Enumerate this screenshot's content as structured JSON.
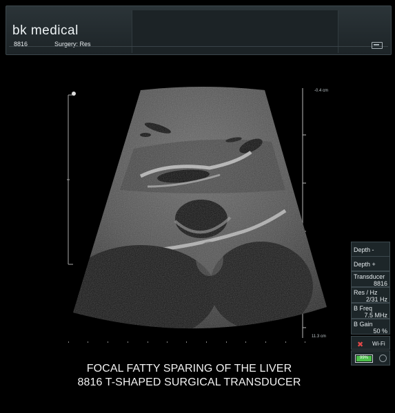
{
  "header": {
    "brand": "bk medical",
    "transducer_id": "8816",
    "mode_label": "Surgery: Res"
  },
  "scan": {
    "depth_top": "-0.4 cm",
    "depth_bottom": "11.3 cm"
  },
  "caption": {
    "line1": "FOCAL FATTY SPARING OF THE LIVER",
    "line2": "8816  T-SHAPED SURGICAL TRANSDUCER"
  },
  "controls": {
    "depth_minus": "Depth -",
    "depth_plus": "Depth +",
    "transducer_label": "Transducer",
    "transducer_value": "8816",
    "res_label": "Res / Hz",
    "res_value": "2/31 Hz",
    "bfreq_label": "B Freq",
    "bfreq_value": "7.5 MHz",
    "bgain_label": "B Gain",
    "bgain_value": "50 %",
    "wifi_label": "Wi-Fi",
    "battery_text": "99%",
    "battery_level": 0.99
  },
  "colors": {
    "accent": "#4cc04b",
    "wifi_off": "#e14848",
    "panel_bg": "#1d2629"
  },
  "icons": [
    "wifi-off-icon",
    "battery-icon",
    "power-icon",
    "storage-icon"
  ]
}
